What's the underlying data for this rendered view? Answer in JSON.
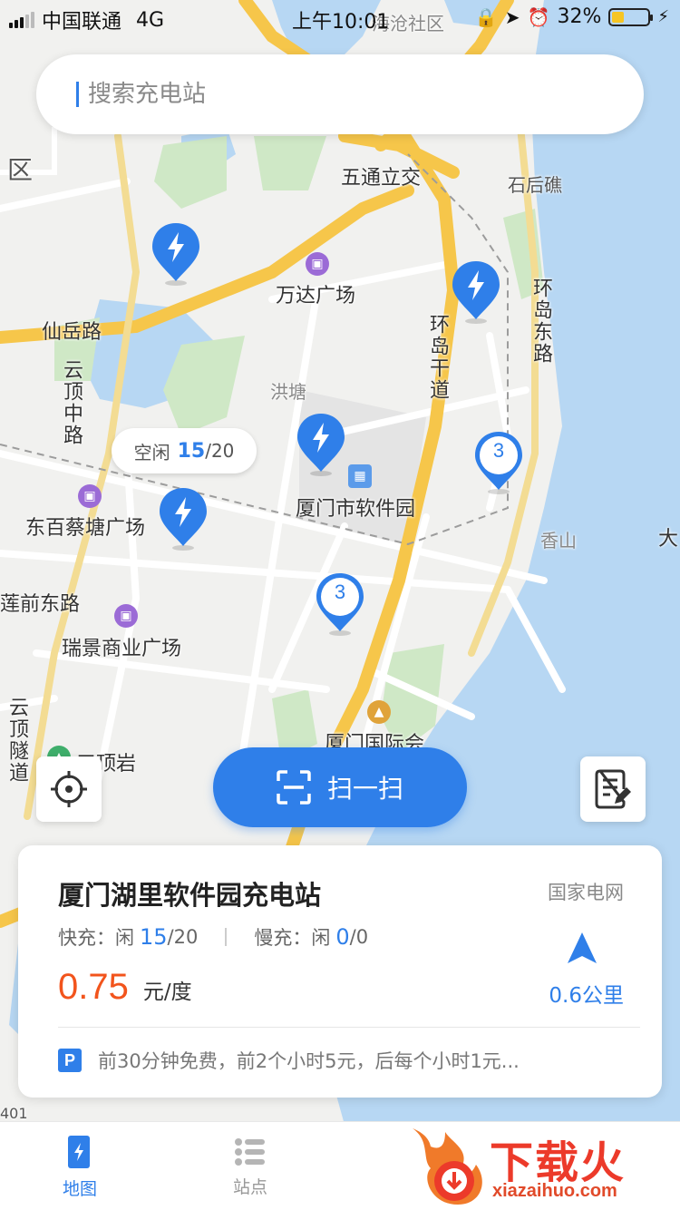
{
  "status_bar": {
    "carrier": "中国联通",
    "network": "4G",
    "time": "上午10:01",
    "battery": "32%",
    "battery_level": 0.32
  },
  "search": {
    "placeholder": "搜索充电站"
  },
  "map": {
    "labels": {
      "district_top": "海沧社区",
      "district_left": "区",
      "interchange": "五通立交",
      "shihoujiao": "石后礁",
      "wanda": "万达广场",
      "xianyue_road": "仙岳路",
      "huandao_east": "环岛东路",
      "huandao_trunk": "环岛干道",
      "yunding_mid": "云顶中路",
      "hongtang": "洪塘",
      "software_park": "厦门市软件园",
      "dongbai_plaza": "东百蔡塘广场",
      "xiangshan": "香山",
      "da": "大",
      "lianqian_east": "莲前东路",
      "ruijing_plaza": "瑞景商业广场",
      "yunding_tunnel": "云顶隧道",
      "sanding_rock": "三顶岩",
      "xiamen_intl": "厦门国际会",
      "road_401": "401"
    },
    "idle_bubble": {
      "prefix": "空闲",
      "free": "15",
      "total": "/20"
    },
    "clusters": [
      {
        "count": "3"
      },
      {
        "count": "3"
      }
    ]
  },
  "scan_button": {
    "label": "扫一扫"
  },
  "station_card": {
    "name": "厦门湖里软件园充电站",
    "operator": "国家电网",
    "fast_label": "快充：闲",
    "fast_free": "15",
    "fast_total": "/20",
    "slow_label": "慢充：闲",
    "slow_free": "0",
    "slow_total": "/0",
    "price": "0.75",
    "price_unit": "元/度",
    "distance": "0.6公里",
    "parking_badge": "P",
    "parking_info": "前30分钟免费，前2个小时5元，后每个小时1元..."
  },
  "tabs": [
    {
      "label": "地图"
    },
    {
      "label": "站点"
    }
  ],
  "watermark": {
    "text": "下载火",
    "url": "xiazaihuo.com"
  },
  "colors": {
    "accent": "#2f7fe9",
    "price": "#f2541c",
    "road_main": "#f6c64a",
    "water": "#b7d7f3"
  }
}
